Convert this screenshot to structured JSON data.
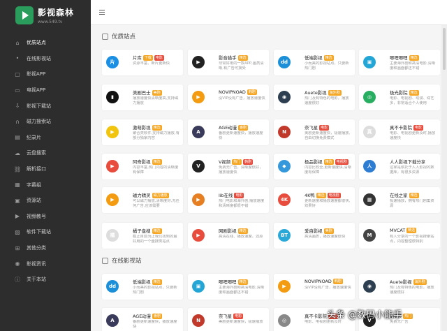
{
  "brand": {
    "title": "影视森林",
    "url": "www.549.tv"
  },
  "nav": [
    {
      "label": "优质站点",
      "icon": "home-icon",
      "g": "⌂"
    },
    {
      "label": "在线影视站",
      "icon": "pin-icon",
      "g": "•"
    },
    {
      "label": "影视APP",
      "icon": "app-icon",
      "g": "▢"
    },
    {
      "label": "电视APP",
      "icon": "tv-icon",
      "g": "▭"
    },
    {
      "label": "影视下载站",
      "icon": "download-icon",
      "g": "⇩"
    },
    {
      "label": "磁力搜索站",
      "icon": "magnet-icon",
      "g": "∩"
    },
    {
      "label": "纪录片",
      "icon": "film-icon",
      "g": "▤"
    },
    {
      "label": "云盘搜索",
      "icon": "cloud-icon",
      "g": "☁"
    },
    {
      "label": "解析接口",
      "icon": "link-icon",
      "g": "⛓"
    },
    {
      "label": "字幕组",
      "icon": "subtitle-icon",
      "g": "▦"
    },
    {
      "label": "资源站",
      "icon": "folder-icon",
      "g": "▣"
    },
    {
      "label": "视频教号",
      "icon": "video-icon",
      "g": "▶"
    },
    {
      "label": "软件下载站",
      "icon": "software-icon",
      "g": "▧"
    },
    {
      "label": "其他分类",
      "icon": "grid-icon",
      "g": "⊞"
    },
    {
      "label": "影视资讯",
      "icon": "news-icon",
      "g": "◉"
    },
    {
      "label": "关于本站",
      "icon": "info-icon",
      "g": "ⓘ"
    }
  ],
  "sections": [
    {
      "title": "优质站点"
    },
    {
      "title": "在线影视站"
    }
  ],
  "colors": {
    "accent": "#2a9d5c",
    "sidebar": "#2d2d2d"
  },
  "cards": [
    {
      "name": "片库",
      "tags": [
        {
          "t": "下载",
          "c": "#f5a623"
        },
        {
          "t": "电影",
          "c": "#e74c3c"
        }
      ],
      "desc": "资源丰富、新片更新快",
      "icon": "片",
      "bg": "#1a8fe3"
    },
    {
      "name": "影音猎手",
      "tags": [
        {
          "t": "精选",
          "c": "#f5a623"
        }
      ],
      "desc": "非常好用的一款APP,画质清晰,有广告可接受",
      "icon": "▶",
      "bg": "#222"
    },
    {
      "name": "低端影视",
      "tags": [
        {
          "t": "精选",
          "c": "#f5a623"
        }
      ],
      "desc": "小而美的影视站点，只要新热门剧",
      "icon": "dd",
      "bg": "#1b8fd8"
    },
    {
      "name": "唧哩唧哩",
      "tags": [
        {
          "t": "精选",
          "c": "#f5a623"
        }
      ],
      "desc": "主要海外剧和高清电影,清晰度和画面都还不错",
      "icon": "▣",
      "bg": "#23a6d5"
    },
    {
      "name": "美剧巴士",
      "tags": [
        {
          "t": "美剧",
          "c": "#f5a623"
        }
      ],
      "desc": "播放速度快清晰度高,支持磁力播放",
      "icon": "▮",
      "bg": "#111"
    },
    {
      "name": "NOVIPNOAD",
      "tags": [
        {
          "t": "韩剧",
          "c": "#f5a623"
        }
      ],
      "desc": "没VIP没有广告，播放速度快",
      "icon": "▶",
      "bg": "#f39c12"
    },
    {
      "name": "Auete影视",
      "tags": [
        {
          "t": "海外剧",
          "c": "#f5a623"
        }
      ],
      "desc": "热门及有特色的电影，播放速度很好",
      "icon": "◉",
      "bg": "#2c3e50"
    },
    {
      "name": "极光影院",
      "tags": [
        {
          "t": "精选",
          "c": "#f5a623"
        }
      ],
      "desc": "电影、电视剧、动漫、综艺多，非常适合个人使用",
      "icon": "◎",
      "bg": "#27ae60"
    },
    {
      "name": "激萌影视",
      "tags": [
        {
          "t": "精选",
          "c": "#f5a623"
        }
      ],
      "desc": "聚合类软件,支持磁力播放,有部分独家内容",
      "icon": "▶",
      "bg": "#f1c40f"
    },
    {
      "name": "AGE动漫",
      "tags": [
        {
          "t": "番剧",
          "c": "#f5a623"
        }
      ],
      "desc": "番剧更新速度快，播放速度快",
      "icon": "A",
      "bg": "#3a3a5a"
    },
    {
      "name": "奈飞星",
      "tags": [
        {
          "t": "电影",
          "c": "#e74c3c"
        }
      ],
      "desc": "美剧更新速度快，极速播放,自由切换免费模式",
      "icon": "N",
      "bg": "#c0392b"
    },
    {
      "name": "真不卡影院",
      "tags": [
        {
          "t": "电影",
          "c": "#e74c3c"
        }
      ],
      "desc": "电影、电视剧更新及时,播放速度快",
      "icon": "真",
      "bg": "#ddd"
    },
    {
      "name": "阿奇影视",
      "tags": [
        {
          "t": "精选",
          "c": "#f5a623"
        }
      ],
      "desc": "内容丰富,热门内容的清晰度有保障",
      "icon": "▶",
      "bg": "#e74c3c"
    },
    {
      "name": "V视频",
      "tags": [
        {
          "t": "热门",
          "c": "#f5a623"
        },
        {
          "t": "韩剧",
          "c": "#e74c3c"
        }
      ],
      "desc": "免费无广告，清晰度很好，播放速度快",
      "icon": "V",
      "bg": "#222"
    },
    {
      "name": "极品影视",
      "tags": [
        {
          "t": "精选",
          "c": "#f5a623"
        },
        {
          "t": "电视剧",
          "c": "#e74c3c"
        }
      ],
      "desc": "内容比较全,更新速度快,清晰度有保障",
      "icon": "◆",
      "bg": "#3498db"
    },
    {
      "name": "人人影视下载分享",
      "tags": [],
      "desc": "这家是依托于人人影视的数据库，有很多资源",
      "icon": "人",
      "bg": "#2d7dd2"
    },
    {
      "name": "磁力精灵",
      "tags": [
        {
          "t": "磁力播放",
          "c": "#f5a623"
        }
      ],
      "desc": "可以磁力播放,清晰度好,无任何广告,应该需要",
      "icon": "▶",
      "bg": "#f39c12"
    },
    {
      "name": "lib在线",
      "tags": [
        {
          "t": "电影",
          "c": "#e74c3c"
        }
      ],
      "desc": "热门电影和海外剧,播放速度和清晰度都很不错",
      "icon": "▶",
      "bg": "#e67e22"
    },
    {
      "name": "4K鸭",
      "tags": [
        {
          "t": "精选",
          "c": "#f5a623"
        },
        {
          "t": "电视剧",
          "c": "#e74c3c"
        }
      ],
      "desc": "更新速度和播放速度都很快,效果好",
      "icon": "4K",
      "bg": "#e74c3c"
    },
    {
      "name": "在线之家",
      "tags": [
        {
          "t": "精选",
          "c": "#f5a623"
        }
      ],
      "desc": "极速播放，拥有热门剧集资源",
      "icon": "▦",
      "bg": "#333"
    },
    {
      "name": "橘子盘搜",
      "tags": [
        {
          "t": "精选",
          "c": "#f5a623"
        }
      ],
      "desc": "截止目前为止我们找到的最好用的一个盘搜类站点",
      "icon": "橘",
      "bg": "#ddd"
    },
    {
      "name": "网剧影视",
      "tags": [
        {
          "t": "精选",
          "c": "#f5a623"
        }
      ],
      "desc": "高清在线、播放速度，还原",
      "icon": "▶",
      "bg": "#e74c3c"
    },
    {
      "name": "爱自影视",
      "tags": [
        {
          "t": "美剧",
          "c": "#f5a623"
        }
      ],
      "desc": "高清画质，播放速度很快",
      "icon": "BT",
      "bg": "#2aa8d8"
    },
    {
      "name": "MVCAT",
      "tags": [
        {
          "t": "精选",
          "c": "#f5a623"
        }
      ],
      "desc": "有人分享的一个影视搜索站点，内容整理很特别",
      "icon": "M",
      "bg": "#444"
    },
    {
      "name": "低端影视",
      "tags": [
        {
          "t": "精选",
          "c": "#f5a623"
        }
      ],
      "desc": "小而美的影视站点，只要新热门剧",
      "icon": "dd",
      "bg": "#1b8fd8"
    },
    {
      "name": "唧哩唧哩",
      "tags": [
        {
          "t": "精选",
          "c": "#f5a623"
        }
      ],
      "desc": "主要海外剧和高清电影,清晰度和画面都还不错",
      "icon": "▣",
      "bg": "#23a6d5"
    },
    {
      "name": "NOVIPNOAD",
      "tags": [
        {
          "t": "韩剧",
          "c": "#f5a623"
        }
      ],
      "desc": "没VIP没有广告，播放速度快",
      "icon": "▶",
      "bg": "#f39c12"
    },
    {
      "name": "Auete影视",
      "tags": [
        {
          "t": "海外剧",
          "c": "#f5a623"
        }
      ],
      "desc": "热门及有特色的电影，播放速度很好",
      "icon": "◉",
      "bg": "#2c3e50"
    },
    {
      "name": "AGE动漫",
      "tags": [
        {
          "t": "番剧",
          "c": "#f5a623"
        }
      ],
      "desc": "番剧更新速度快，播放速度快",
      "icon": "A",
      "bg": "#3a3a5a"
    },
    {
      "name": "奈飞星",
      "tags": [
        {
          "t": "电影",
          "c": "#e74c3c"
        }
      ],
      "desc": "美剧更新速度快，极速播放",
      "icon": "N",
      "bg": "#c0392b"
    },
    {
      "name": "真不卡影院",
      "tags": [
        {
          "t": "电影",
          "c": "#e74c3c"
        }
      ],
      "desc": "电影、电视剧更新及时",
      "icon": "◎",
      "bg": "#888"
    },
    {
      "name": "V视频",
      "tags": [
        {
          "t": "热门",
          "c": "#f5a623"
        }
      ],
      "desc": "免费无广告",
      "icon": "V",
      "bg": "#222"
    }
  ],
  "watermark": "头条 @数码小能手"
}
